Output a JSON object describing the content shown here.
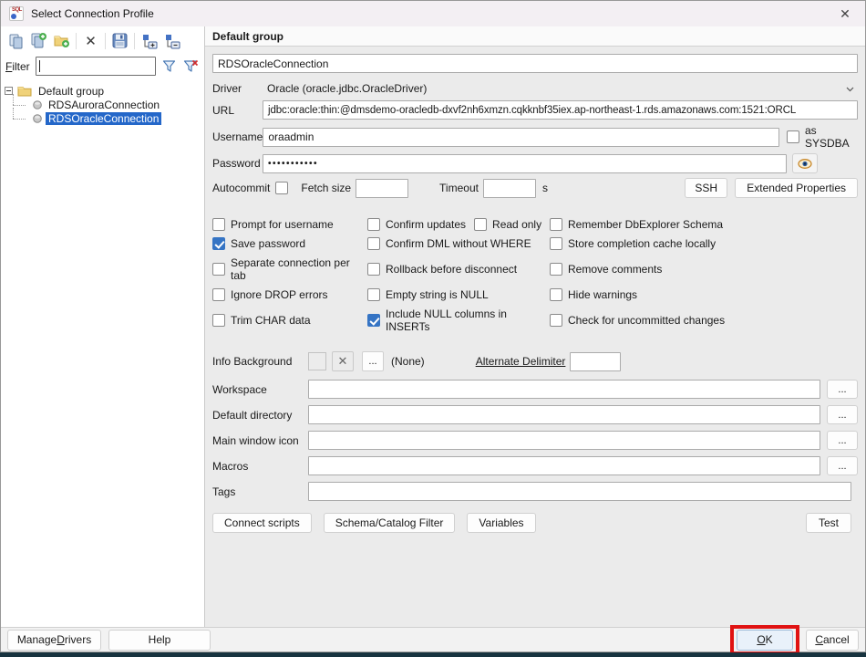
{
  "titlebar": {
    "icon_text": "SQL",
    "title": "Select Connection Profile",
    "close_glyph": "✕"
  },
  "toolbar": {
    "icons": [
      "copy-profile",
      "duplicate-profile",
      "new-group-folder",
      "delete-profile",
      "save-profiles",
      "expand-groups",
      "collapse-groups"
    ],
    "delete_glyph": "✕"
  },
  "filter": {
    "label_mnemonic": "F",
    "label_rest": "ilter",
    "value": ""
  },
  "tree": {
    "group": {
      "label": "Default group"
    },
    "items": [
      {
        "label": "RDSAuroraConnection",
        "selected": false
      },
      {
        "label": "RDSOracleConnection",
        "selected": true
      }
    ]
  },
  "panel": {
    "header": "Default group"
  },
  "profile": {
    "name": "RDSOracleConnection",
    "driver": {
      "label": "Driver",
      "value": "Oracle (oracle.jdbc.OracleDriver)"
    },
    "url": {
      "label": "URL",
      "value": "jdbc:oracle:thin:@dmsdemo-oracledb-dxvf2nh6xmzn.cqkknbf35iex.ap-northeast-1.rds.amazonaws.com:1521:ORCL"
    },
    "username": {
      "label": "Username",
      "value": "oraadmin"
    },
    "as_sysdba": {
      "label": "as SYSDBA",
      "checked": false
    },
    "password": {
      "label": "Password",
      "value": "•••••••••••"
    },
    "autocommit": {
      "label": "Autocommit",
      "checked": false
    },
    "fetch_size": {
      "label": "Fetch size",
      "value": ""
    },
    "timeout": {
      "label": "Timeout",
      "value": "",
      "unit": "s"
    },
    "ssh": "SSH",
    "extended_properties": "Extended Properties"
  },
  "options": {
    "prompt_for_username": {
      "label": "Prompt for username",
      "checked": false
    },
    "confirm_updates": {
      "label": "Confirm updates",
      "checked": false
    },
    "read_only": {
      "label": "Read only",
      "checked": false
    },
    "remember_dbexplorer_schema": {
      "label": "Remember DbExplorer Schema",
      "checked": false
    },
    "save_password": {
      "label": "Save password",
      "checked": true
    },
    "confirm_dml_without_where": {
      "label": "Confirm DML without WHERE",
      "checked": false
    },
    "store_completion_cache_locally": {
      "label": "Store completion cache locally",
      "checked": false
    },
    "separate_connection_per_tab": {
      "label": "Separate connection per tab",
      "checked": false
    },
    "rollback_before_disconnect": {
      "label": "Rollback before disconnect",
      "checked": false
    },
    "remove_comments": {
      "label": "Remove comments",
      "checked": false
    },
    "ignore_drop_errors": {
      "label": "Ignore DROP errors",
      "checked": false
    },
    "empty_string_is_null": {
      "label": "Empty string is NULL",
      "checked": false
    },
    "hide_warnings": {
      "label": "Hide warnings",
      "checked": false
    },
    "trim_char_data": {
      "label": "Trim CHAR data",
      "checked": false
    },
    "include_null_columns_in_inserts": {
      "label": "Include NULL columns in INSERTs",
      "checked": true
    },
    "check_for_uncommitted_changes": {
      "label": "Check for uncommitted changes",
      "checked": false
    }
  },
  "info": {
    "background_label": "Info Background",
    "clear_glyph": "✕",
    "browse": "...",
    "none": "(None)",
    "alternate_delimiter": {
      "label": "Alternate Delimiter",
      "value": ""
    }
  },
  "paths": {
    "workspace": {
      "label": "Workspace",
      "value": ""
    },
    "default_directory": {
      "label": "Default directory",
      "value": ""
    },
    "main_window_icon": {
      "label": "Main window icon",
      "value": ""
    },
    "macros": {
      "label": "Macros",
      "value": ""
    },
    "tags": {
      "label": "Tags",
      "value": ""
    },
    "browse": "..."
  },
  "actions": {
    "connect_scripts": "Connect scripts",
    "schema_catalog_filter": "Schema/Catalog Filter",
    "variables": "Variables",
    "test": "Test"
  },
  "footer": {
    "manage_drivers": {
      "pre": "Manage ",
      "mnemonic": "D",
      "post": "rivers"
    },
    "help": "Help",
    "ok": {
      "mnemonic": "O",
      "post": "K"
    },
    "cancel": {
      "mnemonic": "C",
      "post": "ancel"
    }
  },
  "colors": {
    "selection_blue": "#2467c9",
    "checkbox_checked_blue": "#3574c4",
    "annotation_red": "#e01212",
    "titlebar": "#f3eff3",
    "panel_grey": "#ebebeb",
    "screen_edge_dark": "#17333f"
  }
}
